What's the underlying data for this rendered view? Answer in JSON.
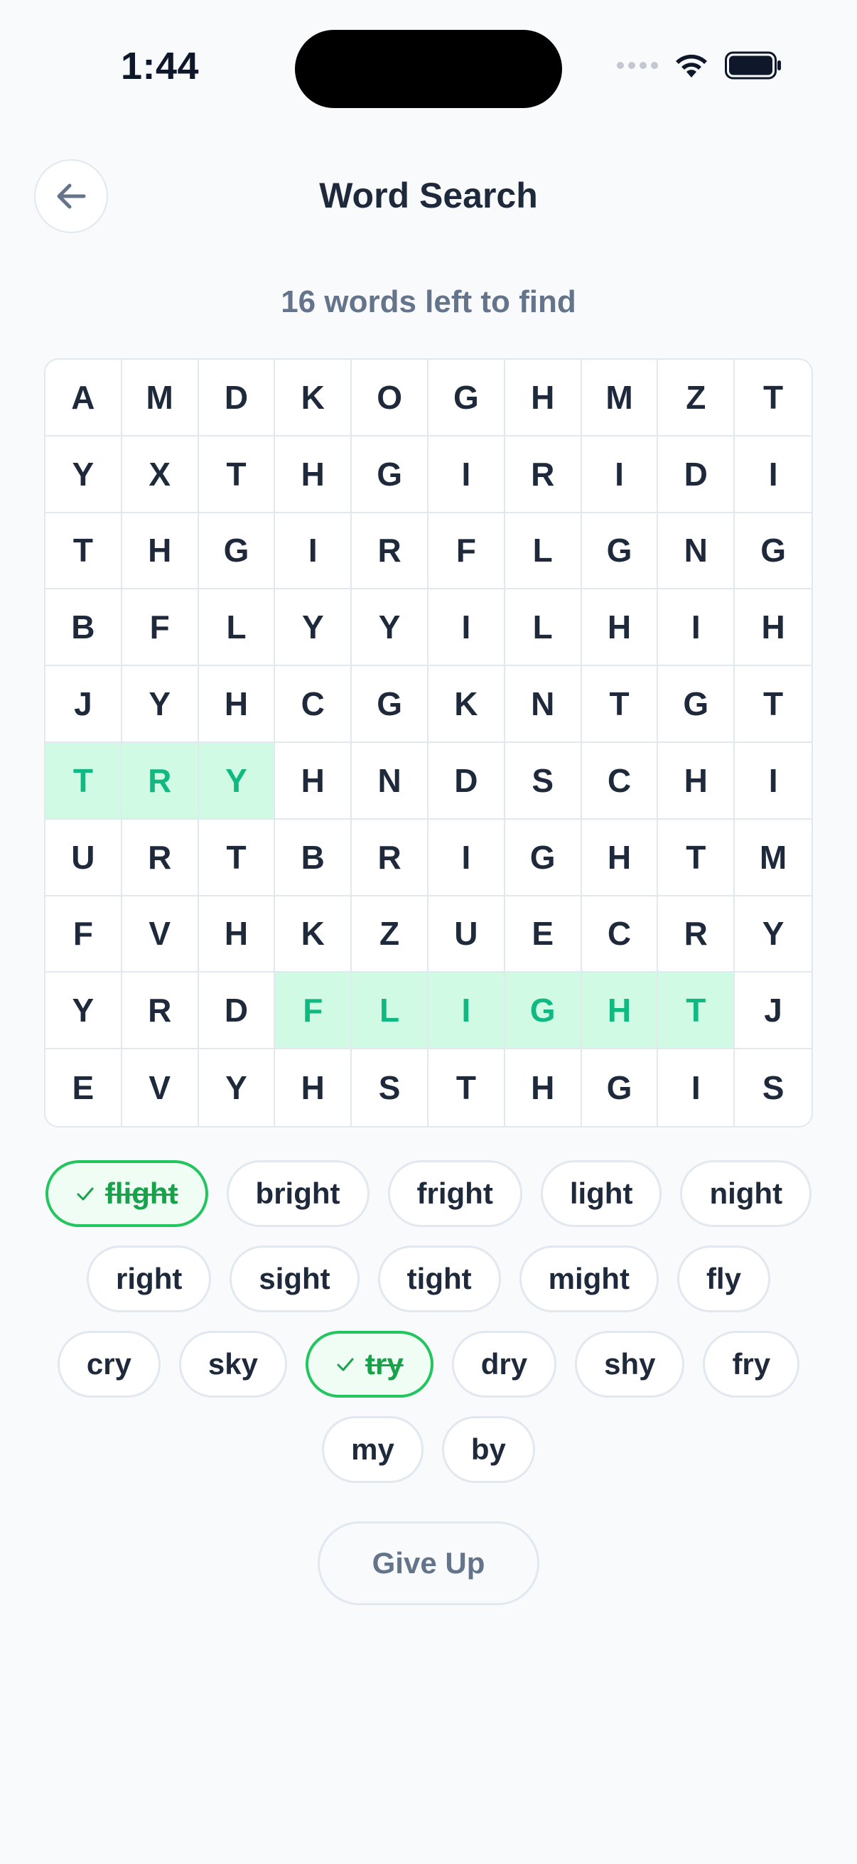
{
  "status_bar": {
    "time": "1:44",
    "icons": [
      "cellular-signal-icon",
      "wifi-icon",
      "battery-icon"
    ]
  },
  "header": {
    "title": "Word Search",
    "back_icon": "arrow-left-icon"
  },
  "progress": {
    "words_left_text": "16 words left to find"
  },
  "grid": {
    "rows": [
      [
        "A",
        "M",
        "D",
        "K",
        "O",
        "G",
        "H",
        "M",
        "Z",
        "T"
      ],
      [
        "Y",
        "X",
        "T",
        "H",
        "G",
        "I",
        "R",
        "I",
        "D",
        "I"
      ],
      [
        "T",
        "H",
        "G",
        "I",
        "R",
        "F",
        "L",
        "G",
        "N",
        "G"
      ],
      [
        "B",
        "F",
        "L",
        "Y",
        "Y",
        "I",
        "L",
        "H",
        "I",
        "H"
      ],
      [
        "J",
        "Y",
        "H",
        "C",
        "G",
        "K",
        "N",
        "T",
        "G",
        "T"
      ],
      [
        "T",
        "R",
        "Y",
        "H",
        "N",
        "D",
        "S",
        "C",
        "H",
        "I"
      ],
      [
        "U",
        "R",
        "T",
        "B",
        "R",
        "I",
        "G",
        "H",
        "T",
        "M"
      ],
      [
        "F",
        "V",
        "H",
        "K",
        "Z",
        "U",
        "E",
        "C",
        "R",
        "Y"
      ],
      [
        "Y",
        "R",
        "D",
        "F",
        "L",
        "I",
        "G",
        "H",
        "T",
        "J"
      ],
      [
        "E",
        "V",
        "Y",
        "H",
        "S",
        "T",
        "H",
        "G",
        "I",
        "S"
      ]
    ],
    "found_cells": [
      [
        5,
        0
      ],
      [
        5,
        1
      ],
      [
        5,
        2
      ],
      [
        8,
        3
      ],
      [
        8,
        4
      ],
      [
        8,
        5
      ],
      [
        8,
        6
      ],
      [
        8,
        7
      ],
      [
        8,
        8
      ]
    ]
  },
  "words": [
    {
      "label": "flight",
      "found": true
    },
    {
      "label": "bright",
      "found": false
    },
    {
      "label": "fright",
      "found": false
    },
    {
      "label": "light",
      "found": false
    },
    {
      "label": "night",
      "found": false
    },
    {
      "label": "right",
      "found": false
    },
    {
      "label": "sight",
      "found": false
    },
    {
      "label": "tight",
      "found": false
    },
    {
      "label": "might",
      "found": false
    },
    {
      "label": "fly",
      "found": false
    },
    {
      "label": "cry",
      "found": false
    },
    {
      "label": "sky",
      "found": false
    },
    {
      "label": "try",
      "found": true
    },
    {
      "label": "dry",
      "found": false
    },
    {
      "label": "shy",
      "found": false
    },
    {
      "label": "fry",
      "found": false
    },
    {
      "label": "my",
      "found": false
    },
    {
      "label": "by",
      "found": false
    }
  ],
  "actions": {
    "give_up_label": "Give Up"
  },
  "colors": {
    "accent_found": "#22c55e",
    "found_cell_bg": "#d1fae5",
    "found_text": "#10b981",
    "muted_text": "#64748b",
    "border": "#e2e8f0"
  }
}
